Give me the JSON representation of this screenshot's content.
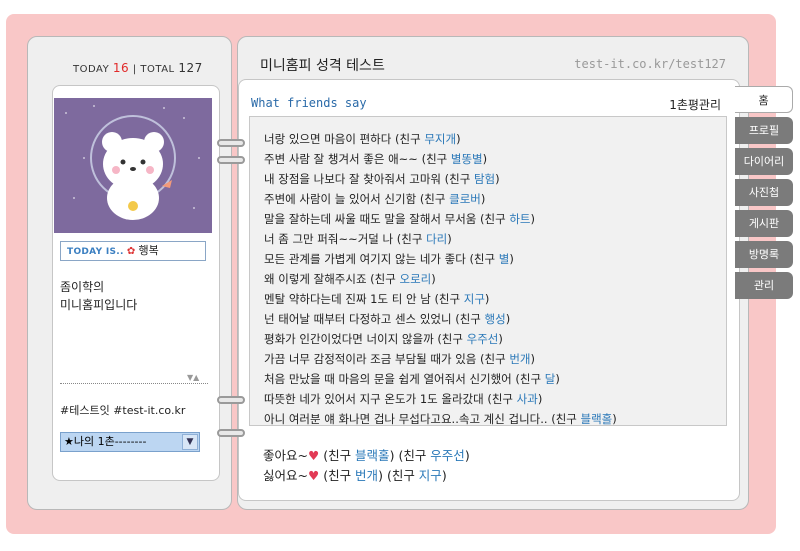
{
  "counter": {
    "today_label": "TODAY",
    "today_value": "16",
    "total_label": "TOTAL",
    "total_value": "127"
  },
  "profile": {
    "today_is_label": "TODAY IS..",
    "mood_icon": "flower-icon",
    "mood": "행복",
    "intro_line1": "좀이학의",
    "intro_line2": "미니홈피입니다",
    "hashtags": "#테스트잇 #test-it.co.kr",
    "ilchon_select": "★나의 1촌--------"
  },
  "header": {
    "title": "미니홈피 성격 테스트",
    "url": "test-it.co.kr/test127"
  },
  "main": {
    "section_title": "What friends say",
    "ilchon_manage": "1촌평관리",
    "comments": [
      {
        "text": "너랑 있으면 마음이 편하다 (친구 ",
        "friend": "무지개",
        "end": ")"
      },
      {
        "text": "주변 사람 잘 챙겨서 좋은 애~~ (친구 ",
        "friend": "별똥별",
        "end": ")"
      },
      {
        "text": "내 장점을 나보다 잘 찾아줘서 고마워 (친구 ",
        "friend": "탐험",
        "end": ")"
      },
      {
        "text": "주변에 사람이 늘 있어서 신기함 (친구 ",
        "friend": "클로버",
        "end": ")"
      },
      {
        "text": "말을 잘하는데 싸울 때도 말을 잘해서 무서움 (친구 ",
        "friend": "하트",
        "end": ")"
      },
      {
        "text": "너 좀 그만 퍼줘~~거덜 나 (친구 ",
        "friend": "다리",
        "end": ")"
      },
      {
        "text": "모든 관계를 가볍게 여기지 않는 네가 좋다 (친구 ",
        "friend": "별",
        "end": ")"
      },
      {
        "text": "왜 이렇게 잘해주시죠 (친구 ",
        "friend": "오로리",
        "end": ")"
      },
      {
        "text": "멘탈 약하다는데 진짜 1도 티 안 남 (친구 ",
        "friend": "지구",
        "end": ")"
      },
      {
        "text": "넌 태어날 때부터 다정하고 센스 있었니 (친구 ",
        "friend": "행성",
        "end": ")"
      },
      {
        "text": "평화가 인간이었다면 너이지 않을까 (친구 ",
        "friend": "우주선",
        "end": ")"
      },
      {
        "text": "가끔 너무 감정적이라 조금 부담될 때가 있음 (친구 ",
        "friend": "번개",
        "end": ")"
      },
      {
        "text": "처음 만났을 때 마음의 문을 쉽게 열어줘서 신기했어 (친구 ",
        "friend": "달",
        "end": ")"
      },
      {
        "text": "따뜻한 네가 있어서 지구 온도가 1도 올라갔대 (친구 ",
        "friend": "사과",
        "end": ")"
      },
      {
        "text": "아니 여러분 얘 화나면 겁나 무섭다고요..속고 계신 겁니다.. (친구 ",
        "friend": "블랙홀",
        "end": ")"
      }
    ],
    "like": {
      "label": "좋아요~",
      "icon": "heart-icon",
      "friend1": "블랙홀",
      "friend2": "우주선"
    },
    "dislike": {
      "label": "싫어요~",
      "icon": "broken-heart-icon",
      "friend1": "번개",
      "friend2": "지구"
    },
    "friend_prefix": "(친구 ",
    "friend_suffix": ")"
  },
  "tabs": [
    "홈",
    "프로필",
    "다이어리",
    "사진첩",
    "게시판",
    "방명록",
    "관리"
  ],
  "colors": {
    "accent": "#2a78b8",
    "frame": "#f9c7c7",
    "today": "#e12a2a",
    "avatar_bg": "#7e6a9e"
  }
}
